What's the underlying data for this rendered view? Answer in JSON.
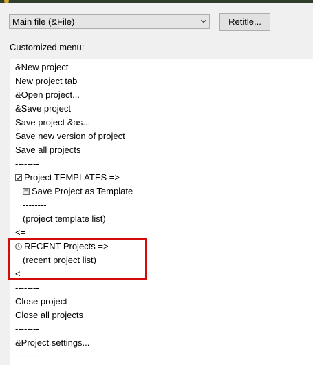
{
  "header": {
    "file_select_value": "Main file (&File)",
    "retitle_label": "Retitle..."
  },
  "section_label": "Customized menu:",
  "menu_items": [
    "&New project",
    "New project tab",
    "&Open project...",
    "&Save project",
    "Save project &as...",
    "Save new version of project",
    "Save all projects",
    "--------",
    "Project TEMPLATES =>",
    "Save Project as Template",
    "--------",
    "(project template list)",
    "<=",
    "RECENT Projects =>",
    "(recent project list)",
    "<=",
    "--------",
    "Close project",
    "Close all projects",
    "--------",
    "&Project settings...",
    "--------"
  ],
  "icons": {
    "templates": "checkbox-icon",
    "save_template": "save-template-icon",
    "recent": "clock-icon"
  },
  "colors": {
    "highlight": "#d40b0b"
  }
}
